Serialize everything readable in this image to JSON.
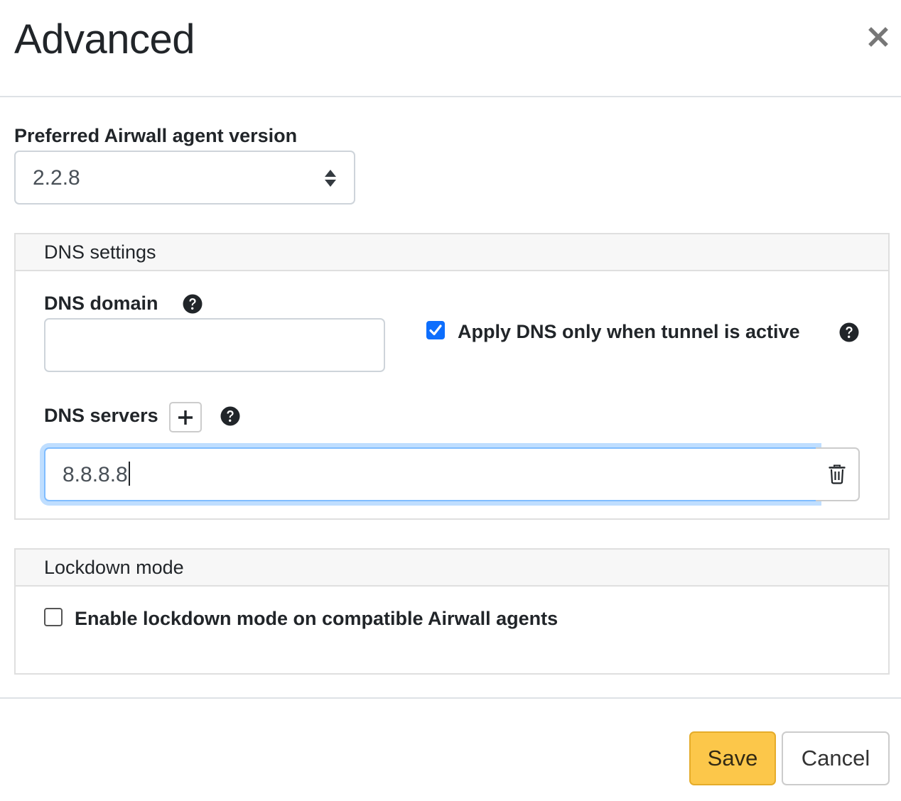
{
  "dialog": {
    "title": "Advanced",
    "close_icon": "close-icon"
  },
  "agent_version": {
    "label": "Preferred Airwall agent version",
    "selected": "2.2.8",
    "icon": "sort-arrows-icon"
  },
  "dns_settings": {
    "header": "DNS settings",
    "domain": {
      "label": "DNS domain",
      "value": "",
      "help_icon": "question-circle-icon"
    },
    "apply_only_when_active": {
      "label": "Apply DNS only when tunnel is active",
      "checked": true,
      "help_icon": "question-circle-icon"
    },
    "servers": {
      "label": "DNS servers",
      "add_icon": "plus-icon",
      "help_icon": "question-circle-icon",
      "entries": [
        {
          "value": "8.8.8.8",
          "delete_icon": "trash-icon"
        }
      ]
    }
  },
  "lockdown": {
    "header": "Lockdown mode",
    "enable": {
      "label": "Enable lockdown mode on compatible Airwall agents",
      "checked": false
    }
  },
  "footer": {
    "save_label": "Save",
    "cancel_label": "Cancel"
  },
  "colors": {
    "accent_checkbox": "#0d6efd",
    "save_button": "#fcc74a",
    "focus_ring": "#80bdff"
  }
}
